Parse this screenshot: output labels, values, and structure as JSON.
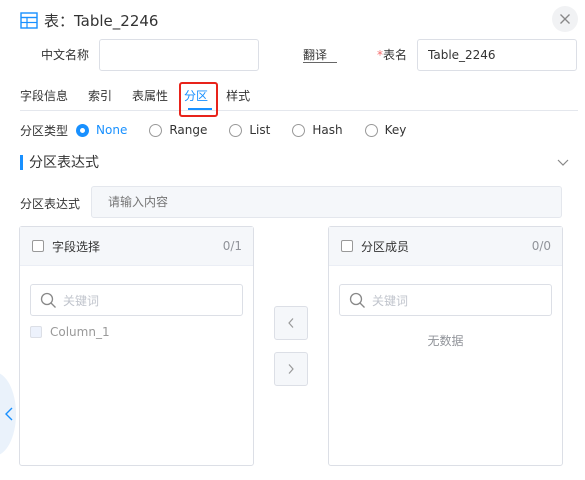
{
  "dialog": {
    "title": "表：Table_2246",
    "close_icon": "close-icon",
    "accent_color": "#1890ff",
    "highlight_color": "#e8231a"
  },
  "form": {
    "cn_name_label": "中文名称",
    "cn_name_value": "",
    "translate_label": "翻译",
    "table_name_required": "*",
    "table_name_label": "表名",
    "table_name_value": "Table_2246"
  },
  "tabs": [
    {
      "label": "字段信息",
      "active": false
    },
    {
      "label": "索引",
      "active": false
    },
    {
      "label": "表属性",
      "active": false
    },
    {
      "label": "分区",
      "active": true
    },
    {
      "label": "样式",
      "active": false
    }
  ],
  "partition_type": {
    "label": "分区类型",
    "options": [
      {
        "label": "None",
        "checked": true
      },
      {
        "label": "Range",
        "checked": false
      },
      {
        "label": "List",
        "checked": false
      },
      {
        "label": "Hash",
        "checked": false
      },
      {
        "label": "Key",
        "checked": false
      }
    ]
  },
  "section": {
    "title": "分区表达式",
    "chevron_icon": "chevron-down-icon"
  },
  "expression": {
    "label": "分区表达式",
    "placeholder": "请输入内容",
    "value": ""
  },
  "transfer": {
    "left": {
      "title": "字段选择",
      "count": "0/1",
      "search_placeholder": "关键词",
      "items": [
        "Column_1"
      ]
    },
    "right": {
      "title": "分区成员",
      "count": "0/0",
      "search_placeholder": "关键词",
      "empty_text": "无数据"
    },
    "move_left_icon": "chevron-left-icon",
    "move_right_icon": "chevron-right-icon"
  },
  "side_toggle_icon": "chevron-left-icon"
}
